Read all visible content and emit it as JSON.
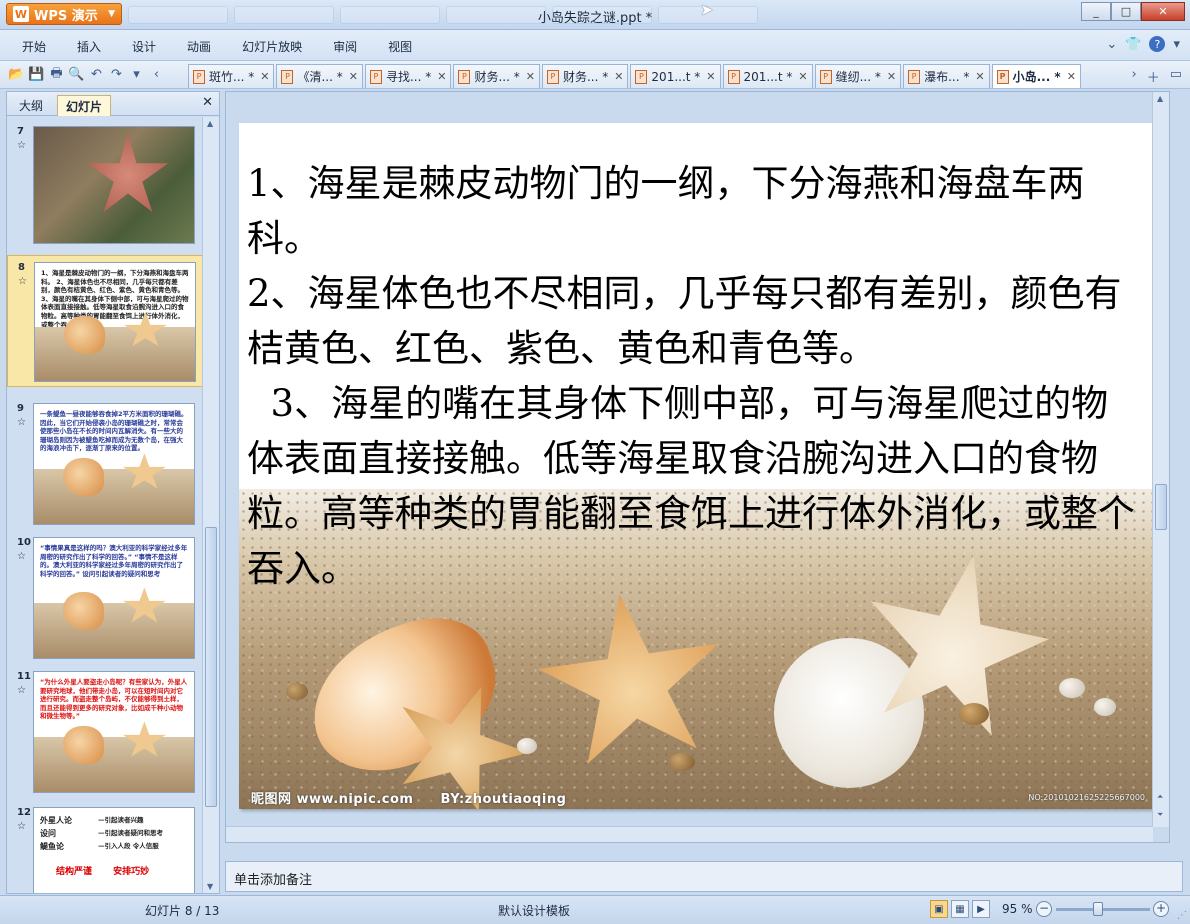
{
  "app": {
    "button_label": "WPS 演示",
    "doc_title": "小岛失踪之谜.ppt *"
  },
  "window": {
    "minimize": "_",
    "maximize": "□",
    "close": "✕"
  },
  "menu": [
    "开始",
    "插入",
    "设计",
    "动画",
    "幻灯片放映",
    "审阅",
    "视图"
  ],
  "doc_tabs": [
    {
      "label": "斑竹... *",
      "active": false
    },
    {
      "label": "《清... *",
      "active": false
    },
    {
      "label": "寻找... *",
      "active": false
    },
    {
      "label": "财务... *",
      "active": false
    },
    {
      "label": "财务... *",
      "active": false
    },
    {
      "label": "201...t *",
      "active": false
    },
    {
      "label": "201...t *",
      "active": false
    },
    {
      "label": "缝纫... *",
      "active": false
    },
    {
      "label": "瀑布... *",
      "active": false
    },
    {
      "label": "小岛... *",
      "active": true
    }
  ],
  "left_panel": {
    "tabs": [
      "大纲",
      "幻灯片"
    ],
    "active_tab": "幻灯片",
    "thumbnails": [
      {
        "num": "7",
        "text": ""
      },
      {
        "num": "8",
        "text": "1、海星是棘皮动物门的一纲，下分海燕和海盘车两科。 2、海星体色也不尽相同，几乎每只都有差别，颜色有桔黄色、红色、紫色、黄色和青色等。 3、海星的嘴在其身体下侧中部，可与海星爬过的物体表面直接接触。低等海星取食沿腕沟进入口的食物粒。高等种类的胃能翻至食饵上进行体外消化，或整个吞入。"
      },
      {
        "num": "9",
        "text": "一条鳀鱼一昼夜能够吞食掉2平方米面积的珊瑚礁。因此，当它们开始侵袭小岛的珊瑚礁之时，常常会使那些小岛在不长的时间内瓦解消失。有一些大的珊瑚岛则因为被鳀鱼吃掉而成为无数个岛，在强大的海浪冲击下，逐渐丁原来的位置。"
      },
      {
        "num": "10",
        "text": "“事情果真是这样的吗？澳大利亚的科学家经过多年周密的研究作出了科学的回答。” “事情不是这样的。澳大利亚的科学家经过多年周密的研究作出了科学的回答。” 设问引起读者的疑问和思考"
      },
      {
        "num": "11",
        "text": "“为什么外星人要盗走小岛呢？有些家认为，外星人要研究地球，他们带走小岛，可以在短时间内对它进行研究。而盗走整个岛屿，不仅能够得到土样，而且还能得到更多的研究对象，比如成千种小动物和微生物等。”"
      },
      {
        "num": "12",
        "text": "外星人论 设问 鳀鱼论"
      }
    ],
    "thumb12": {
      "lines": [
        "外星人论",
        "设问",
        "鳀鱼论"
      ],
      "right_lines": [
        "—引起读者兴趣",
        "—引起读者疑问和思考",
        "—引入人段  令人信服"
      ],
      "caption_left": "结构严谨",
      "caption_right": "安排巧妙"
    }
  },
  "slide": {
    "paragraphs": [
      "1、海星是棘皮动物门的一纲，下分海燕和海盘车两科。",
      "2、海星体色也不尽相同，几乎每只都有差别，颜色有桔黄色、红色、紫色、黄色和青色等。",
      "  3、海星的嘴在其身体下侧中部，可与海星爬过的物体表面直接接触。低等海星取食沿腕沟进入口的食物粒。高等种类的胃能翻至食饵上进行体外消化，或整个吞入。"
    ],
    "watermark_site": "昵图网 www.nipic.com",
    "watermark_author": "BY:zhoutiaoqing",
    "watermark_id": "NO:20101021625225667000"
  },
  "notes_placeholder": "单击添加备注",
  "status": {
    "slide_counter": "幻灯片 8 / 13",
    "template": "默认设计模板",
    "zoom": "95 %",
    "zoom_level_percent": 95
  },
  "colors": {
    "accent_orange": "#e9731a",
    "chrome_blue": "#c9daee",
    "selected_thumb": "#f8e7a6"
  }
}
